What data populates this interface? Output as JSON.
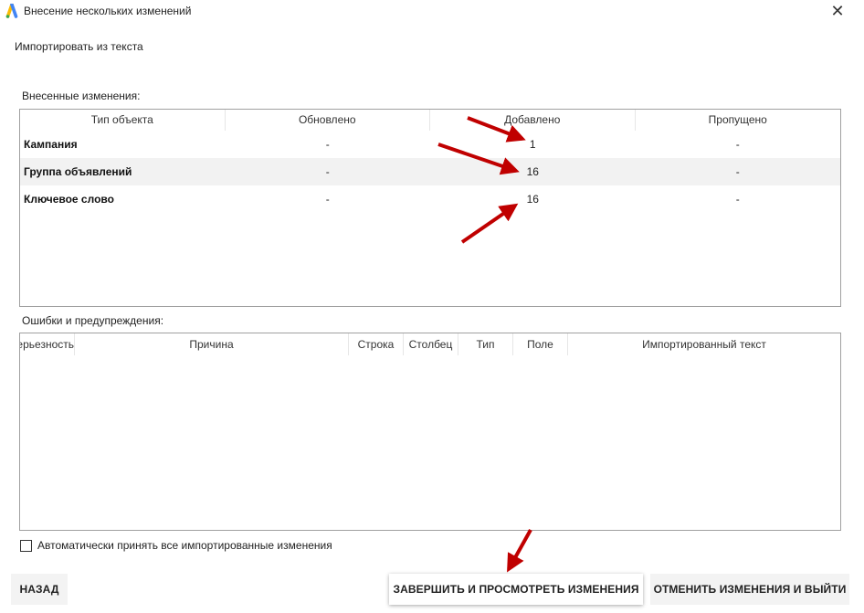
{
  "window": {
    "title": "Внесение нескольких изменений",
    "logo_icon": "google-ads-logo",
    "close_symbol": "✕"
  },
  "subtitle": "Импортировать из текста",
  "changes": {
    "label": "Внесенные изменения:",
    "columns": [
      "Тип объекта",
      "Обновлено",
      "Добавлено",
      "Пропущено"
    ],
    "rows": [
      {
        "name": "Кампания",
        "updated": "-",
        "added": "1",
        "skipped": "-"
      },
      {
        "name": "Группа объявлений",
        "updated": "-",
        "added": "16",
        "skipped": "-"
      },
      {
        "name": "Ключевое слово",
        "updated": "-",
        "added": "16",
        "skipped": "-"
      }
    ]
  },
  "errors": {
    "label": "Ошибки и предупреждения:",
    "columns": [
      "Серьезность",
      "Причина",
      "Строка",
      "Столбец",
      "Тип",
      "Поле",
      "Импортированный текст"
    ]
  },
  "auto_accept": {
    "label": "Автоматически принять все импортированные изменения",
    "checked": false
  },
  "buttons": {
    "back": "НАЗАД",
    "finish": "ЗАВЕРШИТЬ И ПРОСМОТРЕТЬ ИЗМЕНЕНИЯ",
    "cancel": "ОТМЕНИТЬ ИЗМЕНЕНИЯ И ВЫЙТИ"
  },
  "colors": {
    "annotation_arrow": "#c00000",
    "logo_blue": "#4285f4",
    "logo_yellow": "#fbbc04"
  }
}
